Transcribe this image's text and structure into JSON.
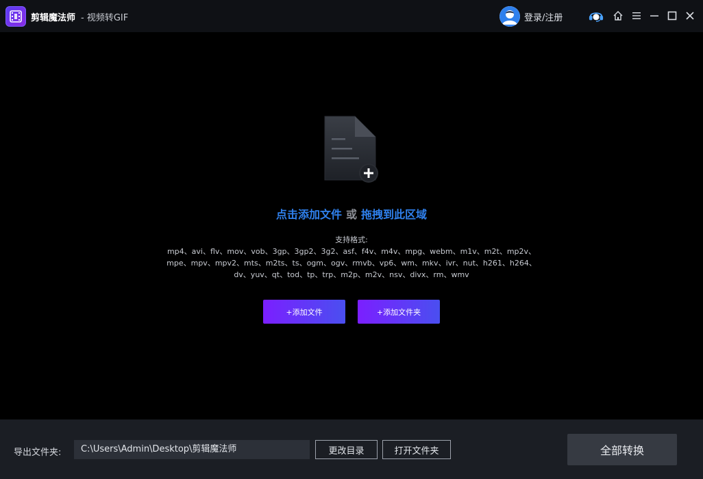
{
  "titlebar": {
    "app_name": "剪辑魔法师",
    "subtitle": "- 视频转GIF",
    "login_label": "登录/注册",
    "icons": [
      "logo-icon",
      "avatar-icon",
      "support-headset-icon",
      "home-icon",
      "menu-icon",
      "minimize-icon",
      "maximize-icon",
      "close-icon"
    ]
  },
  "dropzone": {
    "click_add": "点击添加文件",
    "or": "或",
    "drag_here": "拖拽到此区域",
    "formats_label": "支持格式:",
    "formats_lines": [
      "mp4、avi、flv、mov、vob、3gp、3gp2、3g2、asf、f4v、m4v、mpg、webm、m1v、m2t、mp2v、",
      "mpe、mpv、mpv2、mts、m2ts、ts、ogm、ogv、rmvb、vp6、wm、mkv、ivr、nut、h261、h264、",
      "dv、yuv、qt、tod、tp、trp、m2p、m2v、nsv、divx、rm、wmv"
    ],
    "add_file_button": "+添加文件",
    "add_folder_button": "+添加文件夹"
  },
  "bottombar": {
    "output_label": "导出文件夹:",
    "output_path": "C:\\Users\\Admin\\Desktop\\剪辑魔法师",
    "change_dir_button": "更改目录",
    "open_folder_button": "打开文件夹",
    "convert_all_button": "全部转换"
  },
  "colors": {
    "background": "#000000",
    "titlebar": "#0f1115",
    "bottombar": "#1b1e24",
    "link_blue": "#2f80ed",
    "button_gradient_start": "#7b1fff",
    "button_gradient_end": "#4a4ff0"
  }
}
